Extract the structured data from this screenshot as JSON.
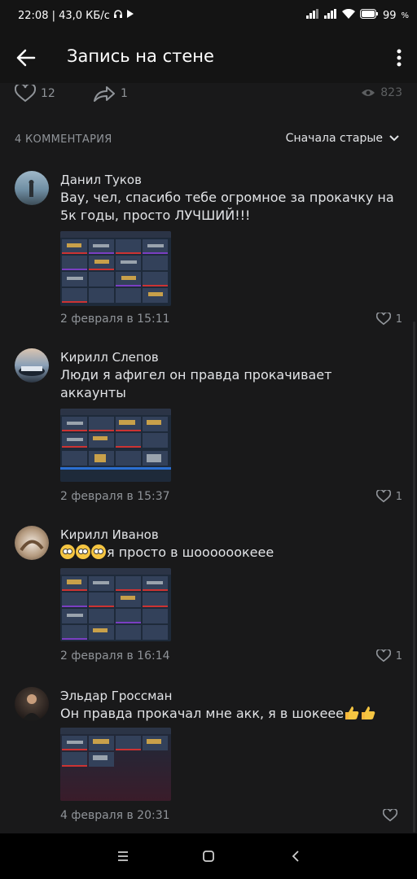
{
  "status_bar": {
    "time_speed": "22:08 | 43,0 КБ/с",
    "battery": "99",
    "battery_unit": "%"
  },
  "header": {
    "title": "Запись на стене"
  },
  "actions": {
    "likes": "12",
    "shares": "1",
    "views": "823"
  },
  "comments_header": {
    "count_label": "4 КОММЕНТАРИЯ",
    "sort_label": "Сначала старые"
  },
  "comments": [
    {
      "author": "Данил Туков",
      "text": "Вау, чел, спасибо тебе огромное за прокачку на 5к годы, просто ЛУЧШИЙ!!!",
      "date": "2 февраля в 15:11",
      "likes": "1"
    },
    {
      "author": "Кирилл Слепов",
      "text": "Люди  я афигел он правда прокачивает аккаунты",
      "date": "2 февраля в 15:37",
      "likes": "1"
    },
    {
      "author": "Кирилл Иванов",
      "text": "я просто в шоооооокеее",
      "date": "2 февраля в 16:14",
      "likes": "1"
    },
    {
      "author": "Эльдар Гроссман",
      "text": "Он правда прокачал мне акк, я в шокеее",
      "date": "4 февраля в 20:31",
      "likes": ""
    }
  ],
  "colors": {
    "background": "#19191a",
    "bar": "#141414",
    "text_primary": "#e1e3e6",
    "text_secondary": "#909499"
  }
}
